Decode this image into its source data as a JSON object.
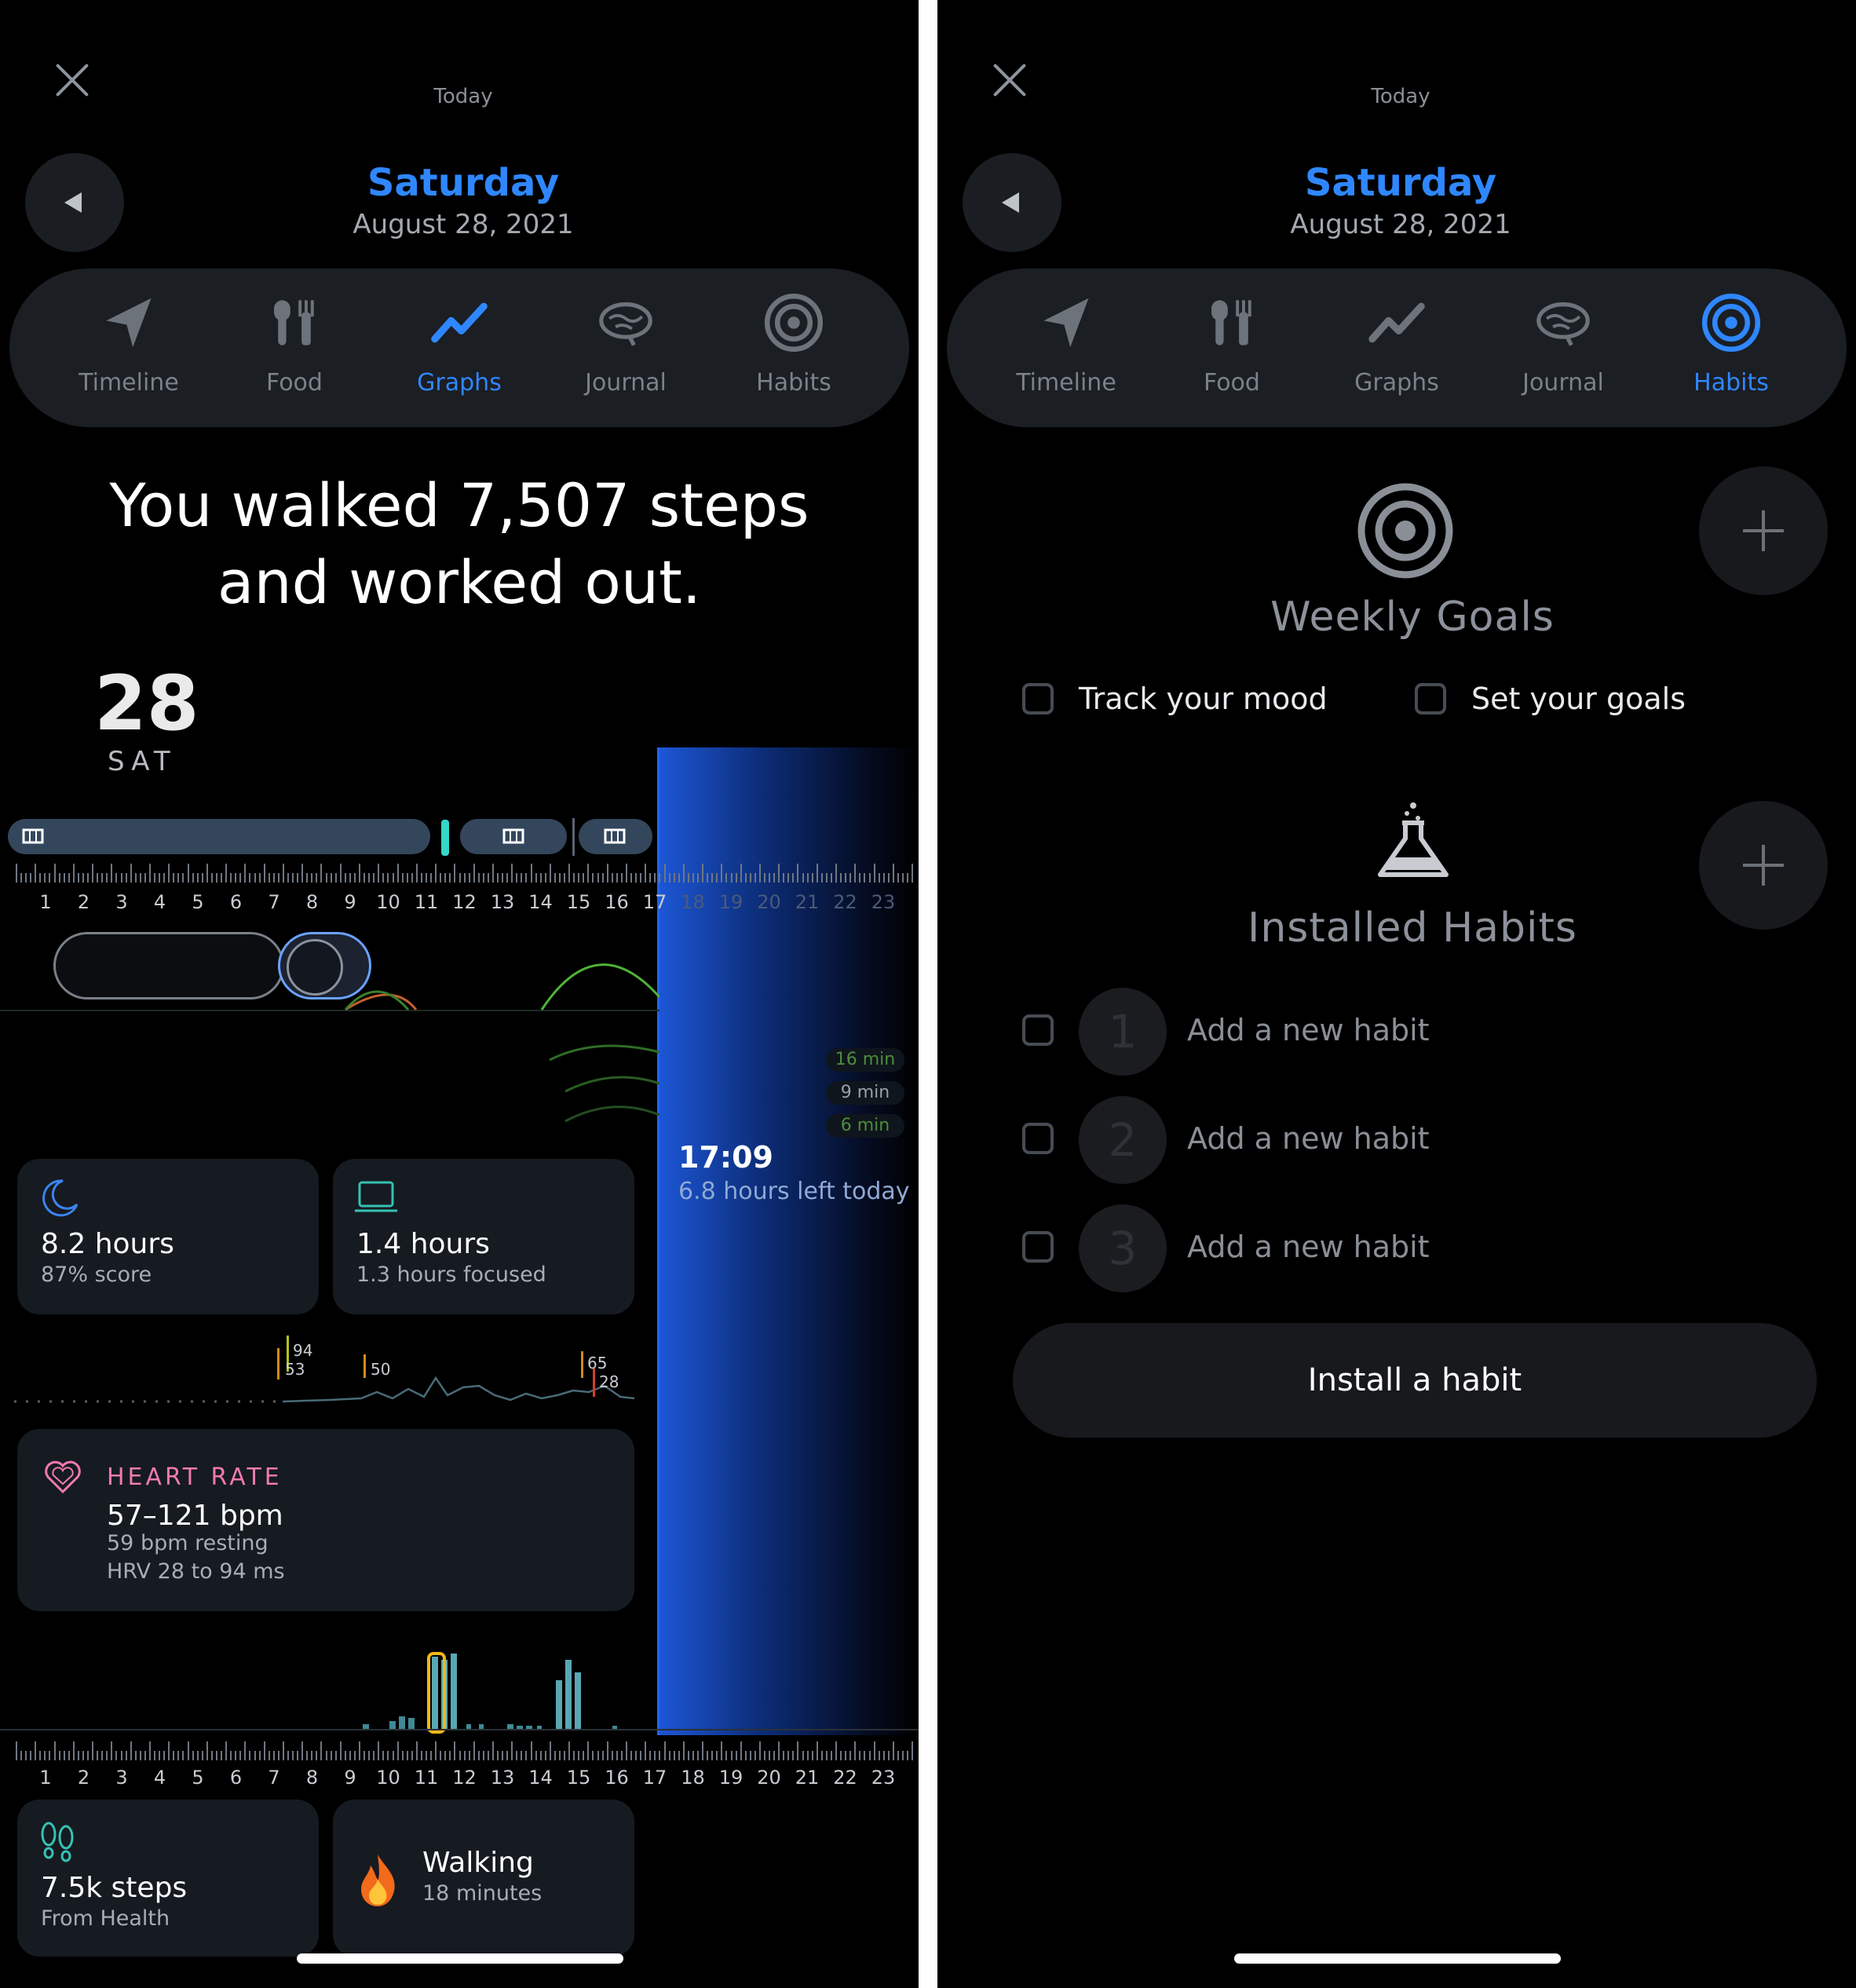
{
  "header": {
    "today_label": "Today",
    "day": "Saturday",
    "date": "August 28, 2021"
  },
  "tabs": [
    {
      "label": "Timeline",
      "icon": "navigation-arrow-icon"
    },
    {
      "label": "Food",
      "icon": "fork-knife-icon"
    },
    {
      "label": "Graphs",
      "icon": "graph-line-icon"
    },
    {
      "label": "Journal",
      "icon": "brain-icon"
    },
    {
      "label": "Habits",
      "icon": "target-icon"
    }
  ],
  "left": {
    "active_tab": "Graphs",
    "summary_line1": "You walked 7,507 steps",
    "summary_line2": "and worked out.",
    "day_number": "28",
    "day_abbr": "SAT",
    "current_time": "17:09",
    "time_left": "6.8 hours left today",
    "hour_labels": [
      "1",
      "2",
      "3",
      "4",
      "5",
      "6",
      "7",
      "8",
      "9",
      "10",
      "11",
      "12",
      "13",
      "14",
      "15",
      "16",
      "17",
      "18",
      "19",
      "20",
      "21",
      "22",
      "23"
    ],
    "duration_badges": [
      "16 min",
      "9 min",
      "6 min"
    ],
    "sleep_card": {
      "title": "8.2 hours",
      "subtitle": "87% score"
    },
    "focus_card": {
      "title": "1.4 hours",
      "subtitle": "1.3 hours focused"
    },
    "hrv_labels": [
      "94",
      "53",
      "50",
      "65",
      "28"
    ],
    "heart_card": {
      "label": "HEART RATE",
      "title": "57–121 bpm",
      "line1": "59 bpm resting",
      "line2": "HRV 28 to 94 ms"
    },
    "steps_card": {
      "title": "7.5k steps",
      "subtitle": "From Health"
    },
    "workout_card": {
      "title": "Walking",
      "subtitle": "18 minutes"
    }
  },
  "right": {
    "active_tab": "Habits",
    "weekly_goals_title": "Weekly Goals",
    "goal_options": [
      "Track your mood",
      "Set your goals"
    ],
    "installed_habits_title": "Installed Habits",
    "habits": [
      {
        "number": "1",
        "label": "Add a new habit"
      },
      {
        "number": "2",
        "label": "Add a new habit"
      },
      {
        "number": "3",
        "label": "Add a new habit"
      }
    ],
    "install_button": "Install a habit"
  },
  "colors": {
    "accent": "#2f87ff",
    "heart": "#f07ab0",
    "marker": "#34d8c8",
    "background": "#000000"
  }
}
